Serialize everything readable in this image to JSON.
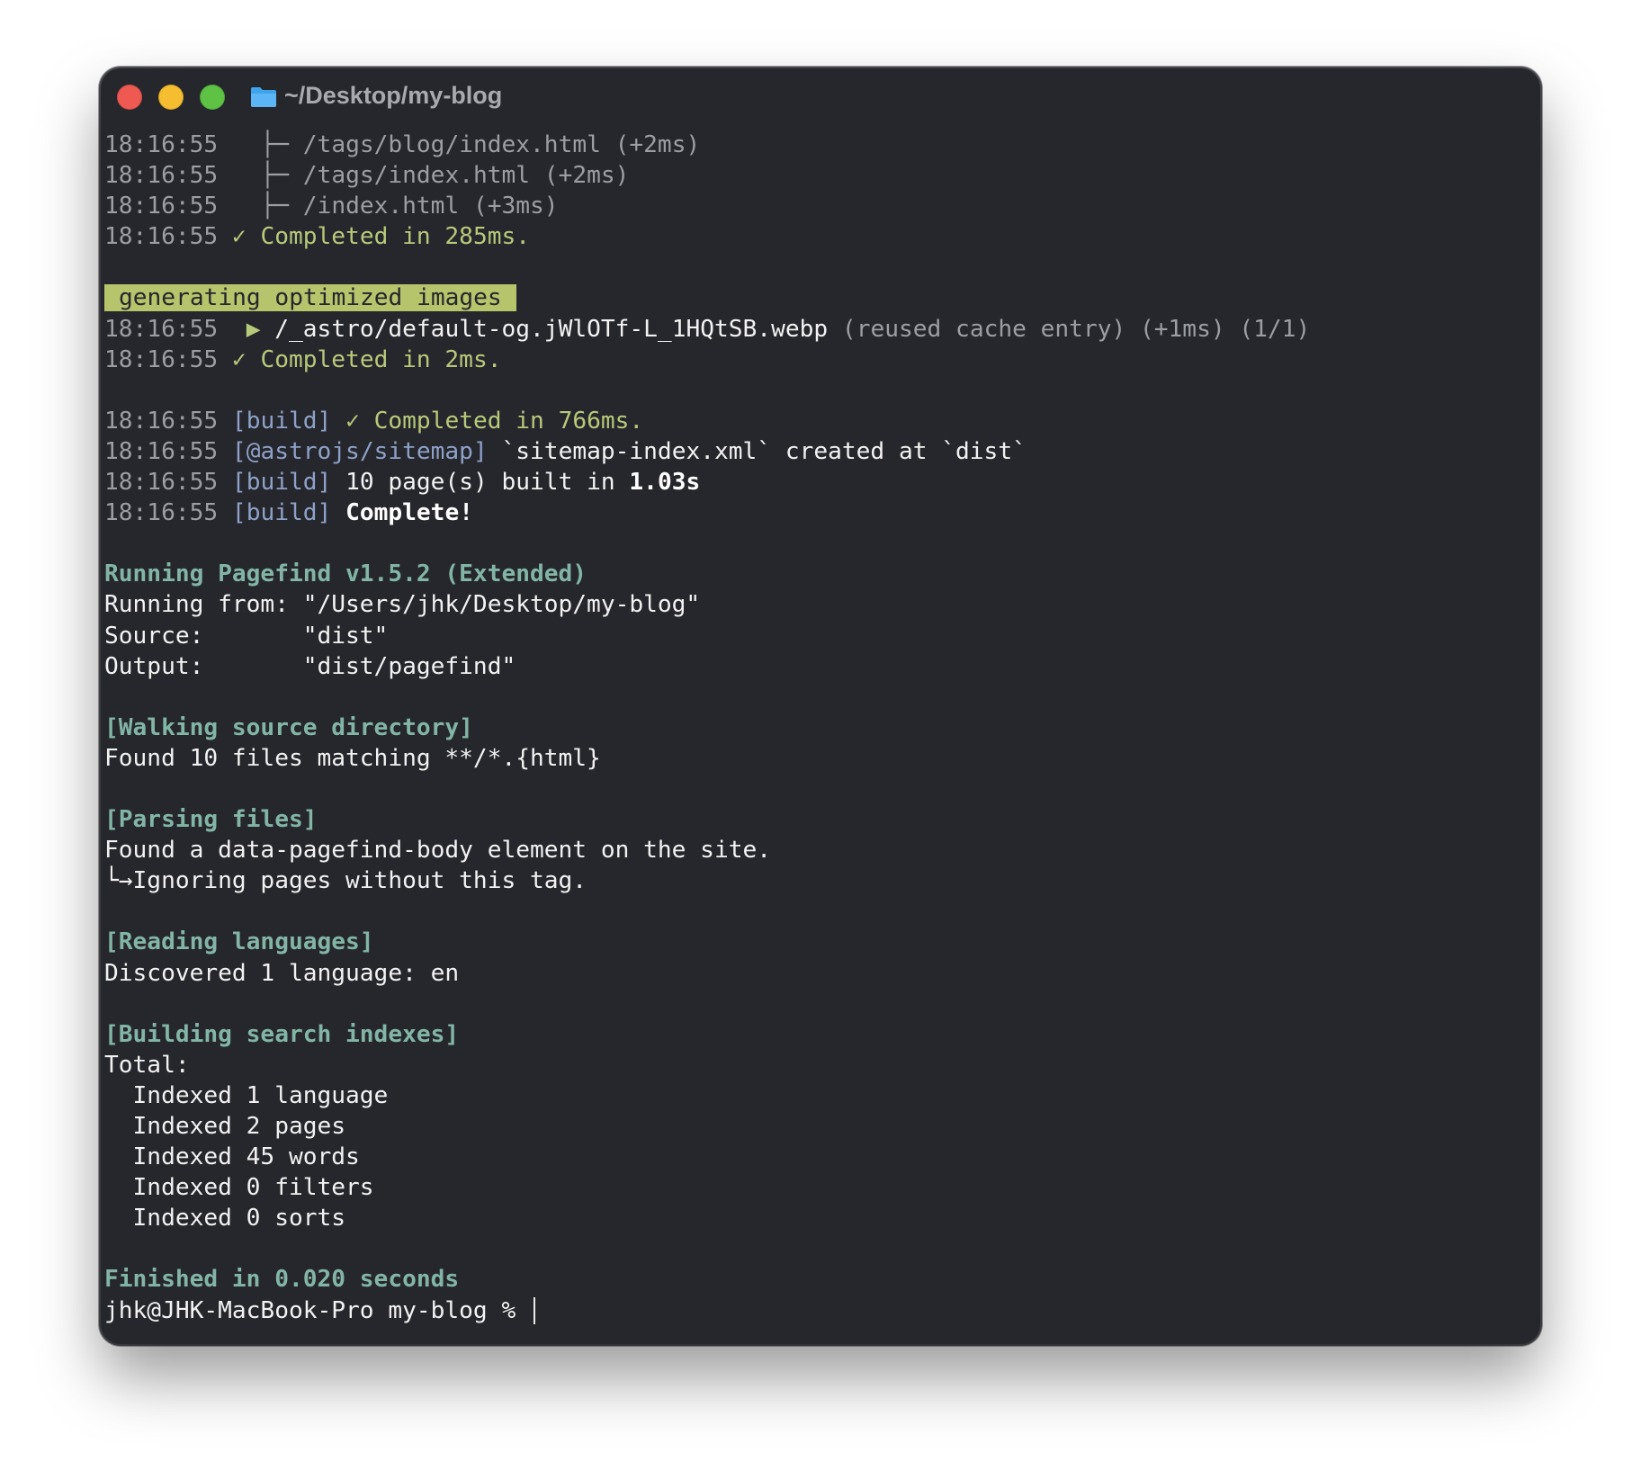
{
  "window": {
    "title": "~/Desktop/my-blog"
  },
  "terminal": {
    "route_lines": [
      {
        "time": "18:16:55",
        "branch": "├─",
        "text": "/tags/blog/index.html (+2ms)"
      },
      {
        "time": "18:16:55",
        "branch": "├─",
        "text": "/tags/index.html (+2ms)"
      },
      {
        "time": "18:16:55",
        "branch": "├─",
        "text": "/index.html (+3ms)"
      }
    ],
    "pages_done": {
      "time": "18:16:55",
      "text": "✓ Completed in 285ms."
    },
    "images_header": "generating optimized images",
    "image_line": {
      "time": "18:16:55",
      "arrow": "▶",
      "path": "/_astro/default-og.jWlOTf-L_1HQtSB.webp",
      "info": "(reused cache entry) (+1ms) (1/1)"
    },
    "images_done": {
      "time": "18:16:55",
      "text": "✓ Completed in 2ms."
    },
    "build_lines": {
      "completed": {
        "time": "18:16:55",
        "tag": "[build]",
        "text": "✓ Completed in 766ms."
      },
      "sitemap": {
        "time": "18:16:55",
        "tag": "[@astrojs/sitemap]",
        "text": "`sitemap-index.xml` created at `dist`"
      },
      "built": {
        "time": "18:16:55",
        "tag": "[build]",
        "text": "10 page(s) built in ",
        "bold": "1.03s"
      },
      "complete": {
        "time": "18:16:55",
        "tag": "[build]",
        "bold": "Complete!"
      }
    },
    "pagefind": {
      "header": "Running Pagefind v1.5.2 (Extended)",
      "running_from": "Running from: \"/Users/jhk/Desktop/my-blog\"",
      "source": "Source:       \"dist\"",
      "output": "Output:       \"dist/pagefind\"",
      "walking_header": "[Walking source directory]",
      "walking_result": "Found 10 files matching **/*.{html}",
      "parsing_header": "[Parsing files]",
      "parsing_result_1": "Found a data-pagefind-body element on the site.",
      "parsing_result_2": "└→Ignoring pages without this tag.",
      "reading_header": "[Reading languages]",
      "reading_result": "Discovered 1 language: en",
      "building_header": "[Building search indexes]",
      "total_label": "Total:",
      "totals": [
        "  Indexed 1 language",
        "  Indexed 2 pages",
        "  Indexed 45 words",
        "  Indexed 0 filters",
        "  Indexed 0 sorts"
      ],
      "finished": "Finished in 0.020 seconds"
    },
    "prompt": "jhk@JHK-MacBook-Pro my-blog % "
  },
  "colors": {
    "background": "#26272c",
    "timestamp": "#9c9ea5",
    "success_green": "#b7c97a",
    "tag_blue": "#8ea1c8",
    "pagefind_teal": "#82b5a6",
    "highlight_bg": "#b6c46c"
  }
}
